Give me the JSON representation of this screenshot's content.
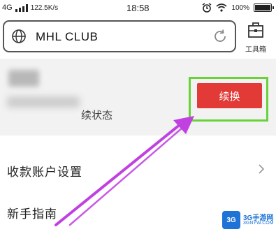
{
  "status_bar": {
    "network": "4G",
    "speed": "122.5K/s",
    "time": "18:58",
    "battery": "100%",
    "icons": [
      "signal-icon",
      "alarm-icon",
      "wifi-icon",
      "battery-icon"
    ]
  },
  "address_bar": {
    "url": "MHL CLUB",
    "icons": [
      "globe-icon",
      "reload-icon"
    ]
  },
  "toolbox": {
    "label": "工具箱",
    "icon": "toolbox-icon"
  },
  "profile": {
    "status_text": "续状态",
    "renew_button": "续换"
  },
  "menu": {
    "items": [
      {
        "label": "收款账户设置",
        "icon": "chevron-right-icon"
      },
      {
        "label": "新手指南"
      }
    ]
  },
  "watermark": {
    "logo": "3G",
    "text": "3G手游网",
    "sub": "3GNYW.COM"
  },
  "colors": {
    "accent_red": "#e23a36",
    "highlight_green": "#69d23a",
    "arrow_purple": "#c040e0",
    "profile_bg": "#f2f2f2"
  }
}
